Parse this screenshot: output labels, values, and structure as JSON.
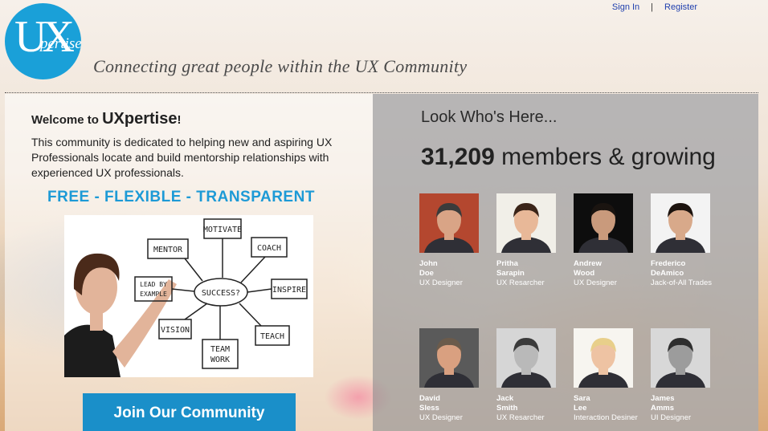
{
  "header": {
    "sign_in": "Sign In",
    "separator": "|",
    "register": "Register",
    "logo": {
      "ux": "UX",
      "pertise": "pertise"
    },
    "tagline": "Connecting great people within the UX Community"
  },
  "welcome": {
    "prefix": "Welcome to ",
    "brand": "UXpertise",
    "suffix": "!",
    "intro": "This community is dedicated to helping new and aspiring UX Professionals locate and build mentorship relationships with experienced UX professionals.",
    "slogan": "FREE - FLEXIBLE - TRANSPARENT",
    "diagram": {
      "center": "SUCCESS?",
      "nodes": [
        "MENTOR",
        "MOTIVATE",
        "COACH",
        "LEAD BY",
        "EXAMPLE",
        "INSPIRE",
        "VISION",
        "TEAM",
        "WORK",
        "TEACH"
      ]
    },
    "join_button": "Join Our Community"
  },
  "members": {
    "heading": "Look Who's Here...",
    "count": "31,209",
    "count_suffix": " members & growing",
    "list": [
      {
        "first": "John",
        "last": "Doe",
        "role": "UX Designer",
        "skin": "#d9a486",
        "hair": "#3b3b3b",
        "bg": "#b4472f"
      },
      {
        "first": "Pritha",
        "last": "Sarapin",
        "role": "UX Resarcher",
        "skin": "#e8b898",
        "hair": "#3a2418",
        "bg": "#f1efe8"
      },
      {
        "first": "Andrew",
        "last": "Wood",
        "role": "UX Designer",
        "skin": "#c99a7c",
        "hair": "#1a1410",
        "bg": "#0d0d0d"
      },
      {
        "first": "Frederico",
        "last": "DeAmico",
        "role": "Jack-of-All Trades",
        "skin": "#d8a98a",
        "hair": "#1c130e",
        "bg": "#f3f3f3"
      },
      {
        "first": "David",
        "last": "Sless",
        "role": "UX Designer",
        "skin": "#d9a080",
        "hair": "#6b5b4b",
        "bg": "#5a5a5a"
      },
      {
        "first": "Jack",
        "last": "Smith",
        "role": "UX Resarcher",
        "skin": "#b9b9b9",
        "hair": "#3a3a3a",
        "bg": "#d6d6d6"
      },
      {
        "first": "Sara",
        "last": "Lee",
        "role": "Interaction Desiner",
        "skin": "#eec3a3",
        "hair": "#e8cf8a",
        "bg": "#f7f5f0"
      },
      {
        "first": "James",
        "last": "Amms",
        "role": "UI Designer",
        "skin": "#9c9c9c",
        "hair": "#2e2e2e",
        "bg": "#d8d8d8"
      }
    ]
  }
}
